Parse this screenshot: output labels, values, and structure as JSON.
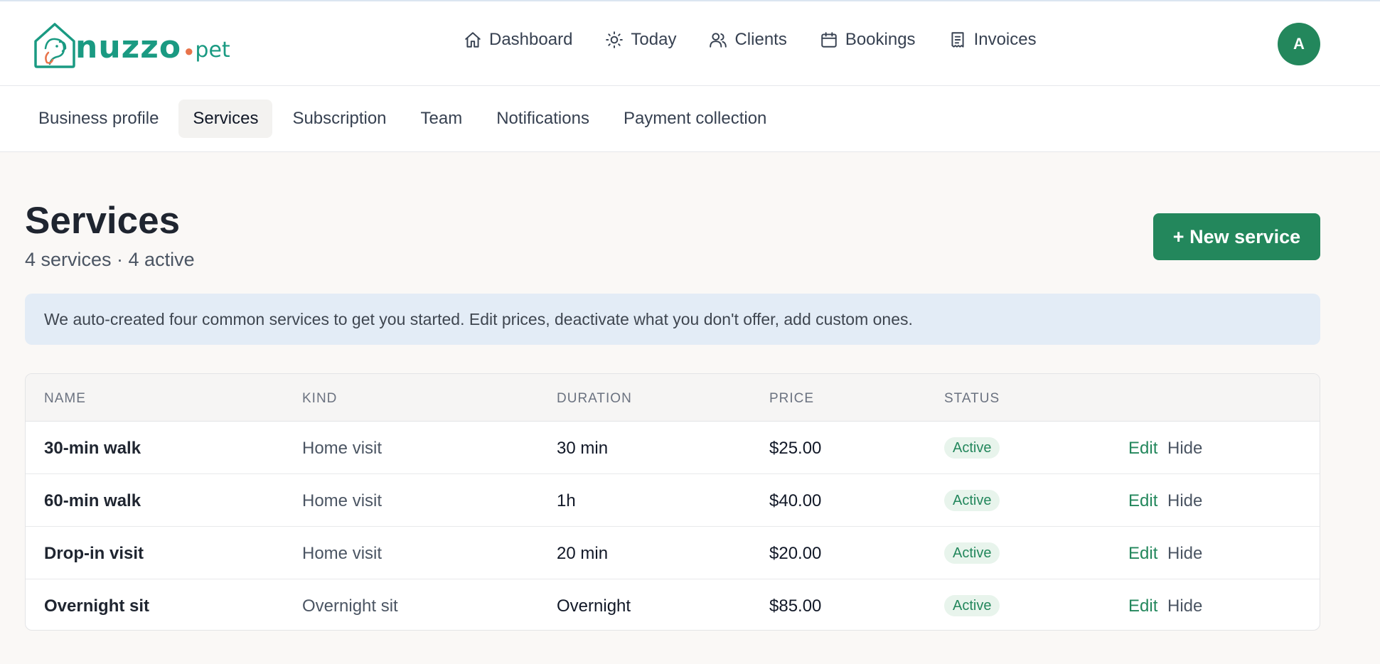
{
  "brand": {
    "name": "nuzzo",
    "suffix": "pet",
    "colors": {
      "primary": "#23875c",
      "logo": "#1a9a82",
      "accent": "#e8734a"
    }
  },
  "nav": {
    "items": [
      {
        "label": "Dashboard",
        "icon": "home-icon"
      },
      {
        "label": "Today",
        "icon": "sun-icon"
      },
      {
        "label": "Clients",
        "icon": "users-icon"
      },
      {
        "label": "Bookings",
        "icon": "calendar-icon"
      },
      {
        "label": "Invoices",
        "icon": "receipt-icon"
      }
    ],
    "avatar_initial": "A"
  },
  "settings_tabs": [
    {
      "label": "Business profile",
      "active": false
    },
    {
      "label": "Services",
      "active": true
    },
    {
      "label": "Subscription",
      "active": false
    },
    {
      "label": "Team",
      "active": false
    },
    {
      "label": "Notifications",
      "active": false
    },
    {
      "label": "Payment collection",
      "active": false
    }
  ],
  "page": {
    "title": "Services",
    "subtitle": "4 services · 4 active",
    "new_button": "+ New service",
    "banner": "We auto-created four common services to get you started. Edit prices, deactivate what you don't offer, add custom ones."
  },
  "table": {
    "columns": [
      "NAME",
      "KIND",
      "DURATION",
      "PRICE",
      "STATUS"
    ],
    "actions": {
      "edit": "Edit",
      "hide": "Hide"
    },
    "rows": [
      {
        "name": "30-min walk",
        "kind": "Home visit",
        "duration": "30 min",
        "price": "$25.00",
        "status": "Active"
      },
      {
        "name": "60-min walk",
        "kind": "Home visit",
        "duration": "1h",
        "price": "$40.00",
        "status": "Active"
      },
      {
        "name": "Drop-in visit",
        "kind": "Home visit",
        "duration": "20 min",
        "price": "$20.00",
        "status": "Active"
      },
      {
        "name": "Overnight sit",
        "kind": "Overnight sit",
        "duration": "Overnight",
        "price": "$85.00",
        "status": "Active"
      }
    ]
  }
}
